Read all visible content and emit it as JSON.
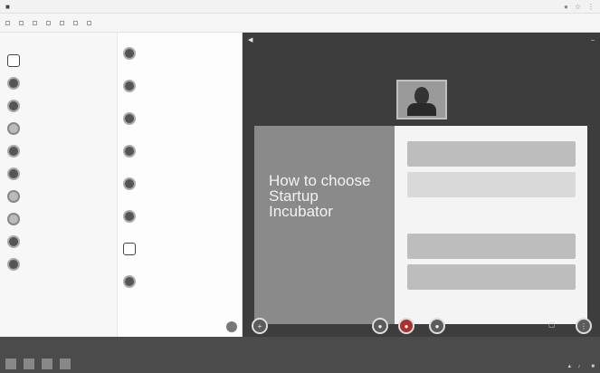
{
  "browser": {
    "url": "",
    "bookmarks": []
  },
  "left": {
    "sections": [],
    "contacts": [
      {},
      {},
      {},
      {},
      {},
      {},
      {},
      {},
      {},
      {}
    ]
  },
  "middle": {
    "header": "",
    "chats": [
      {},
      {},
      {},
      {},
      {},
      {},
      {},
      {},
      {}
    ],
    "compose_placeholder": ""
  },
  "video": {
    "title": "",
    "subtitle": "",
    "slide_title": "How to choose Startup Incubator",
    "slide_rows": [
      "",
      "",
      "",
      "",
      ""
    ]
  },
  "taskbar": {
    "clock": ""
  },
  "colors": {
    "panel_dark": "#3d3d3d",
    "slide_gray": "#8a8a8a",
    "taskbar": "#4b4b4b"
  }
}
